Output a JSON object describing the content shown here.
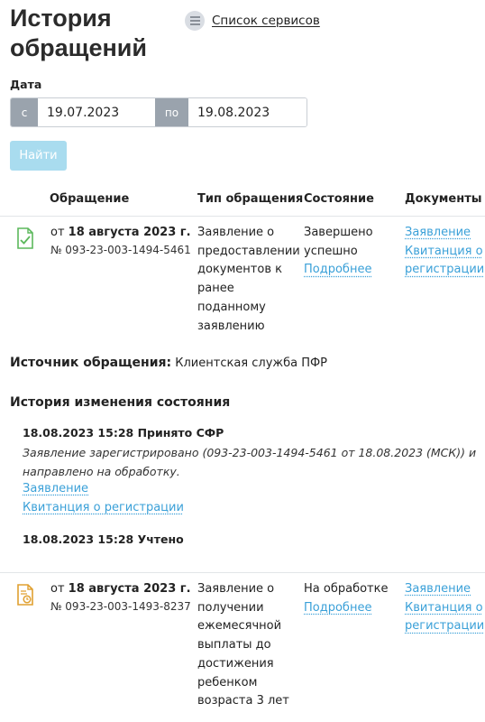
{
  "page": {
    "title_line1": "История",
    "title_line2": "обращений",
    "services_link": "Список сервисов"
  },
  "filter": {
    "date_label": "Дата",
    "from_prefix": "с",
    "from_value": "19.07.2023",
    "to_prefix": "по",
    "to_value": "19.08.2023",
    "find_button": "Найти"
  },
  "table": {
    "headers": [
      "Обращение",
      "Тип обращения",
      "Состояние",
      "Документы"
    ],
    "rows": [
      {
        "date_prefix": "от ",
        "date": "18 августа 2023 г.",
        "number": "№ 093-23-003-1494-5461",
        "type_lines": [
          "Заявление о",
          "предоставлении",
          "документов к",
          "ранее",
          "поданному",
          "заявлению"
        ],
        "status_lines": [
          "Завершено",
          "успешно"
        ],
        "details_link": "Подробнее",
        "doc_link_1": "Заявление",
        "doc_link_2_lines": [
          "Квитанция о",
          "регистрации"
        ],
        "source_label": "Источник обращения:",
        "source_value": "Клиентская служба ПФР",
        "history_title": "История изменения состояния",
        "history": [
          {
            "title": "18.08.2023 15:28 Принято СФР",
            "text_lines": [
              "Заявление зарегистрировано (093-23-003-1494-5461 от 18.08.2023 (МСК)) и",
              "направлено на обработку."
            ],
            "link_1": "Заявление",
            "link_2": "Квитанция о регистрации"
          },
          {
            "title": "18.08.2023 15:28 Учтено"
          }
        ]
      },
      {
        "date_prefix": "от ",
        "date": "18 августа 2023 г.",
        "number": "№ 093-23-003-1493-8237",
        "type_lines": [
          "Заявление о",
          "получении",
          "ежемесячной",
          "выплаты до",
          "достижения",
          "ребенком",
          "возраста 3 лет"
        ],
        "status_lines": [
          "На обработке"
        ],
        "details_link": "Подробнее",
        "doc_link_1": "Заявление",
        "doc_link_2_lines": [
          "Квитанция о",
          "регистрации"
        ]
      }
    ]
  },
  "colors": {
    "success_icon": "#5cb85c",
    "pending_icon": "#e0a030",
    "link": "#3aa0d8",
    "button": "#a9dcef"
  },
  "icons": {
    "row1": "document-check-icon",
    "row2": "document-pending-icon",
    "menu": "menu-icon"
  }
}
